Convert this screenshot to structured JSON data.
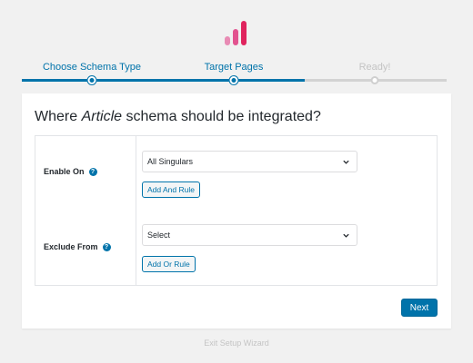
{
  "logo": {
    "icon": "bar-chart-logo",
    "colors": [
      "#e88bb4",
      "#e2538f",
      "#e0245e"
    ]
  },
  "steps": [
    {
      "label": "Choose Schema Type",
      "state": "done"
    },
    {
      "label": "Target Pages",
      "state": "current"
    },
    {
      "label": "Ready!",
      "state": "todo"
    }
  ],
  "card": {
    "title_prefix": "Where ",
    "title_emphasis": "Article",
    "title_suffix": " schema should be integrated?",
    "rows": [
      {
        "label": "Enable On",
        "help_icon": "?",
        "select_value": "All Singulars",
        "button_label": "Add And Rule"
      },
      {
        "label": "Exclude From",
        "help_icon": "?",
        "select_value": "Select",
        "button_label": "Add Or Rule"
      }
    ],
    "next_label": "Next"
  },
  "exit_label": "Exit Setup Wizard",
  "colors": {
    "accent": "#0073aa",
    "muted": "#c4c4c4",
    "background": "#f1f1f1"
  }
}
